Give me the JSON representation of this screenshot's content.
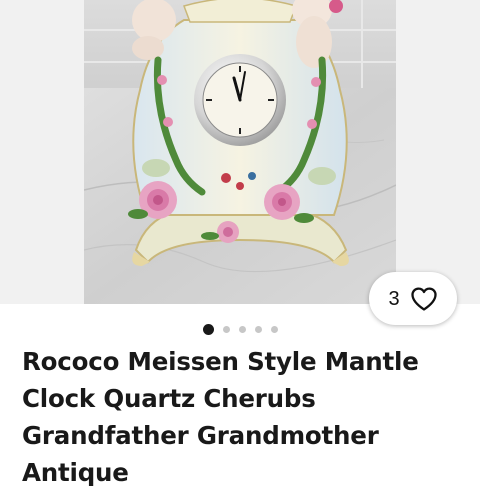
{
  "listing": {
    "title": "Rococo Meissen Style Mantle Clock Quartz Cherubs Grandfather Grandmother Antique",
    "image_description": "Porcelain rococo mantle clock with cherubs and pink roses",
    "watchers": {
      "count": "3",
      "icon": "heart-outline-icon"
    },
    "gallery": {
      "total_images": 5,
      "active_index": 0
    }
  },
  "colors": {
    "title_text": "#191919",
    "dot_active": "#191919",
    "dot_inactive": "#c7c7c7",
    "gallery_bg": "#f1f1f1"
  }
}
